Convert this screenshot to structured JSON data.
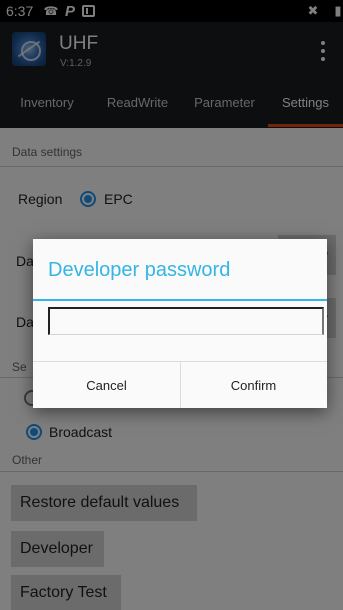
{
  "status_bar": {
    "time": "6:37",
    "icons": [
      "nfc-icon",
      "parking-icon",
      "screenshot-icon",
      "mute-icon",
      "edge-icon"
    ]
  },
  "app_bar": {
    "title": "UHF",
    "version": "V:1.2.9"
  },
  "tabs": [
    {
      "label": "Inventory"
    },
    {
      "label": "ReadWrite"
    },
    {
      "label": "Parameter"
    },
    {
      "label": "Settings",
      "active": true
    }
  ],
  "data_settings": {
    "header": "Data settings",
    "region_label": "Region",
    "region_option": "EPC",
    "row2_label_visible": "Da",
    "row2_button_visible": "y",
    "row3_label_visible": "Da",
    "row3_button_visible": "y"
  },
  "send_settings": {
    "header_visible": "Se",
    "broadcast_label": "Broadcast"
  },
  "other": {
    "header": "Other",
    "restore_label": "Restore default values",
    "developer_label": "Developer",
    "factory_test_label": "Factory Test"
  },
  "dialog": {
    "title": "Developer password",
    "password_value": "",
    "cancel_label": "Cancel",
    "confirm_label": "Confirm"
  },
  "colors": {
    "accent_blue": "#33b5e5",
    "radio_blue": "#2196f3",
    "tab_indicator": "#e64a19",
    "app_bar_bg": "#1b1d1f"
  }
}
